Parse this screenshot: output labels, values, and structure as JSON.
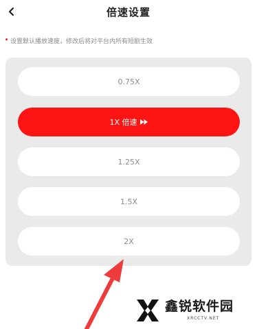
{
  "header": {
    "title": "倍速设置",
    "back_icon": "chevron-left-icon"
  },
  "hint": {
    "text": "设置默认播放速度，修改后将对平台内所有短剧生效"
  },
  "speed_options": [
    {
      "label": "0.75X",
      "selected": false
    },
    {
      "label": "1X 倍速",
      "selected": true,
      "icon": "fast-forward-icon"
    },
    {
      "label": "1.25X",
      "selected": false
    },
    {
      "label": "1.5X",
      "selected": false
    },
    {
      "label": "2X",
      "selected": false
    }
  ],
  "watermark": {
    "name": "鑫锐软件园",
    "url": "XRCCTV.NET"
  },
  "colors": {
    "accent": "#ff1414",
    "panel_bg": "#eaeaea",
    "option_bg": "#ffffff",
    "option_text": "#8b8b8b",
    "hint_text": "#8a8a8a",
    "annotation_arrow": "#ee3b3b"
  }
}
